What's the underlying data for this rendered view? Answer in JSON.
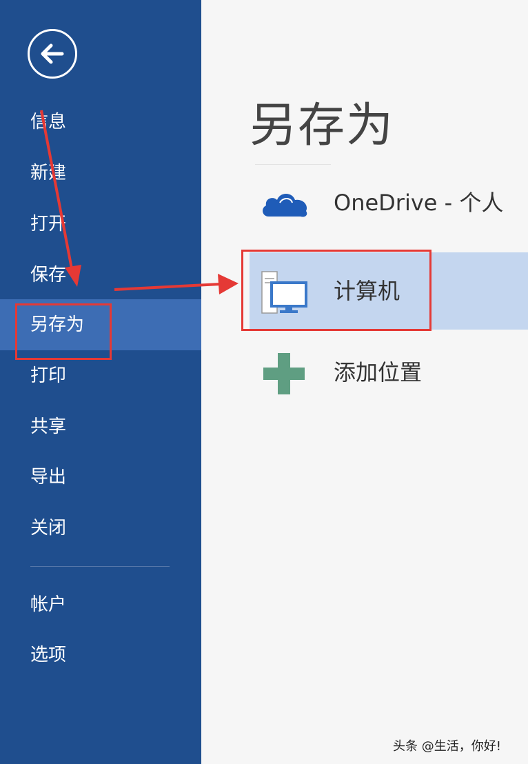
{
  "nav": {
    "items": [
      {
        "label": "信息"
      },
      {
        "label": "新建"
      },
      {
        "label": "打开"
      },
      {
        "label": "保存"
      },
      {
        "label": "另存为"
      },
      {
        "label": "打印"
      },
      {
        "label": "共享"
      },
      {
        "label": "导出"
      },
      {
        "label": "关闭"
      },
      {
        "label": "帐户"
      },
      {
        "label": "选项"
      }
    ],
    "active_index": 4
  },
  "main": {
    "title": "另存为",
    "locations": [
      {
        "label": "OneDrive - 个人",
        "icon": "onedrive-cloud-icon"
      },
      {
        "label": "计算机",
        "icon": "computer-icon",
        "selected": true
      },
      {
        "label": "添加位置",
        "icon": "plus-icon"
      }
    ]
  },
  "annotations": {
    "color": "#e53935"
  },
  "watermark": "头条 @生活，你好!",
  "colors": {
    "sidebar": "#1f4e8e",
    "sidebar_active": "#3d6db4",
    "selected_row": "#c4d6ef",
    "onedrive": "#1f5cb8",
    "plus": "#5f9e82"
  }
}
